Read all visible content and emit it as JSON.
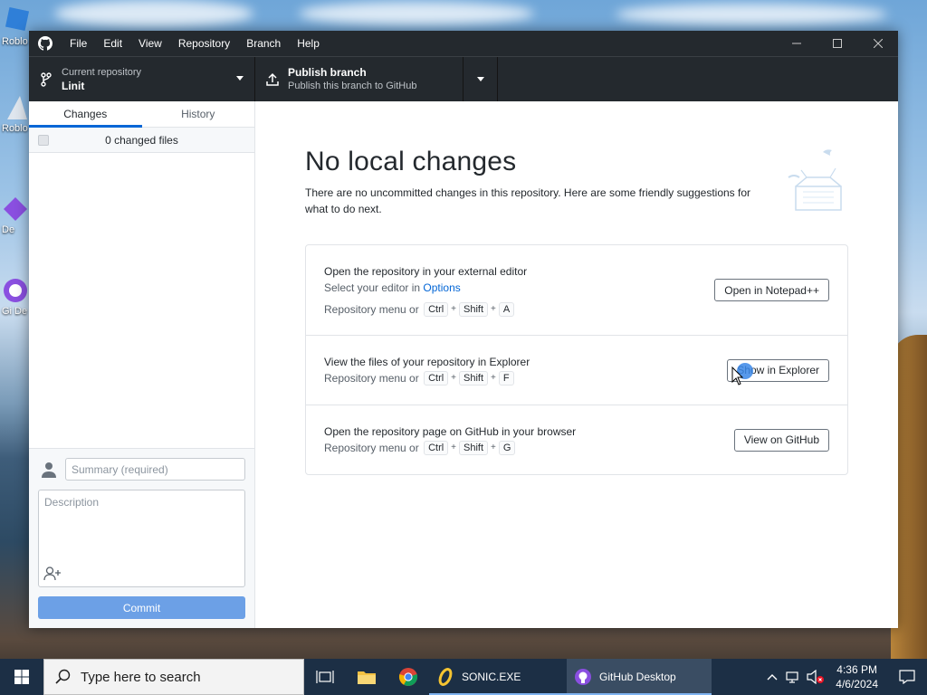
{
  "desktop": {
    "icons": [
      {
        "label": "Roblo"
      },
      {
        "label": "Roblo"
      },
      {
        "label": "De"
      },
      {
        "label": "Gi De"
      }
    ]
  },
  "window": {
    "menu": [
      "File",
      "Edit",
      "View",
      "Repository",
      "Branch",
      "Help"
    ],
    "controls": {
      "minimize": "—",
      "maximize": "☐",
      "close": "✕"
    }
  },
  "toolbar": {
    "repo_caption": "Current repository",
    "repo_name": "Linit",
    "publish_title": "Publish branch",
    "publish_sub": "Publish this branch to GitHub"
  },
  "sidebar": {
    "tabs": [
      "Changes",
      "History"
    ],
    "changed_files": "0 changed files",
    "summary_placeholder": "Summary (required)",
    "description_placeholder": "Description",
    "commit_label": "Commit"
  },
  "main": {
    "title": "No local changes",
    "intro": "There are no uncommitted changes in this repository. Here are some friendly suggestions for what to do next.",
    "suggestions": [
      {
        "title": "Open the repository in your external editor",
        "sub_prefix": "Select your editor in",
        "sub_link": "Options",
        "shortcut_prefix": "Repository menu or",
        "keys": [
          "Ctrl",
          "Shift",
          "A"
        ],
        "button": "Open in Notepad++"
      },
      {
        "title": "View the files of your repository in Explorer",
        "shortcut_prefix": "Repository menu or",
        "keys": [
          "Ctrl",
          "Shift",
          "F"
        ],
        "button": "Show in Explorer"
      },
      {
        "title": "Open the repository page on GitHub in your browser",
        "shortcut_prefix": "Repository menu or",
        "keys": [
          "Ctrl",
          "Shift",
          "G"
        ],
        "button": "View on GitHub"
      }
    ]
  },
  "taskbar": {
    "search_placeholder": "Type here to search",
    "apps": [
      {
        "label": "SONIC.EXE",
        "active": false
      },
      {
        "label": "GitHub Desktop",
        "active": true
      }
    ],
    "time": "4:36 PM",
    "date": "4/6/2024"
  },
  "colors": {
    "titlebar": "#24292e",
    "accent_blue": "#0366d6",
    "commit_button": "#6ca0e6",
    "taskbar": "#1c2f45"
  }
}
